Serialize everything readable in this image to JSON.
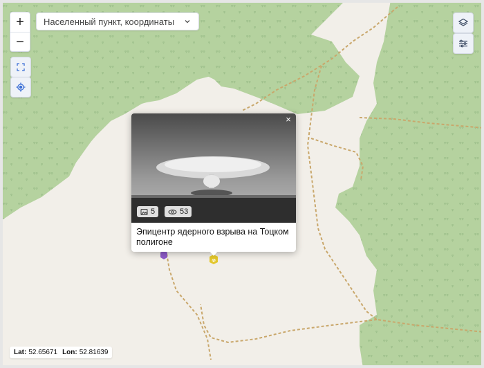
{
  "search": {
    "placeholder": "Населенный пункт, координаты"
  },
  "zoom": {
    "in_label": "+",
    "out_label": "−"
  },
  "icons": {
    "fullscreen": "fullscreen-icon",
    "locate": "locate-icon",
    "layers": "layers-icon",
    "filters": "sliders-icon",
    "chevron": "chevron-down-icon"
  },
  "popup": {
    "title": "Эпицентр ядерного взрыва на Тоцком полигоне",
    "photos_count": "5",
    "views_count": "53",
    "close_label": "×"
  },
  "coords": {
    "lat_label": "Lat:",
    "lat_value": "52.65671",
    "lon_label": "Lon:",
    "lon_value": "52.81639"
  },
  "colors": {
    "land": "#f2efe9",
    "forest": "#b5d29f",
    "road": "#c9a76b",
    "marker_purple": "#8e5bc9",
    "marker_yellow": "#e2c62a"
  }
}
